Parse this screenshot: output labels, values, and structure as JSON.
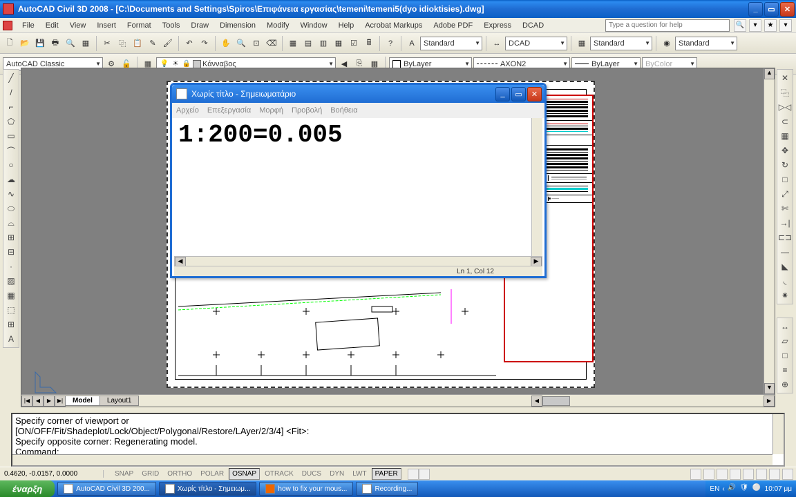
{
  "app": {
    "title": "AutoCAD Civil 3D 2008 - [C:\\Documents and Settings\\Spiros\\Επιφάνεια εργασίας\\temeni\\temeni5(dyo idioktisies).dwg]"
  },
  "menu": {
    "items": [
      "File",
      "Edit",
      "View",
      "Insert",
      "Format",
      "Tools",
      "Draw",
      "Dimension",
      "Modify",
      "Window",
      "Help",
      "Acrobat Markups",
      "Adobe PDF",
      "Express",
      "DCAD"
    ],
    "question_placeholder": "Type a question for help"
  },
  "toolbar_combos": {
    "workspace": "AutoCAD Classic",
    "layer": "Κάνναβος",
    "style1": "Standard",
    "style2": "DCAD",
    "style3": "Standard",
    "style4": "Standard",
    "linetype1": "ByLayer",
    "linetype2": "AXON2",
    "linetype3": "ByLayer",
    "color": "ByColor"
  },
  "tabs": {
    "model": "Model",
    "layout1": "Layout1"
  },
  "notepad": {
    "title": "Χωρίς τίτλο - Σημειωματάριο",
    "menu": [
      "Αρχείο",
      "Επεξεργασία",
      "Μορφή",
      "Προβολή",
      "Βοήθεια"
    ],
    "content": "1:200=0.005",
    "status": "Ln 1, Col 12"
  },
  "command_window": {
    "line1": "Specify corner of viewport or",
    "line2": "[ON/OFF/Fit/Shadeplot/Lock/Object/Polygonal/Restore/LAyer/2/3/4] <Fit>:",
    "line3": "Specify opposite corner: Regenerating model.",
    "line4": "Command:"
  },
  "status": {
    "coords": "0.4620, -0.0157, 0.0000",
    "toggles": [
      "SNAP",
      "GRID",
      "ORTHO",
      "POLAR",
      "OSNAP",
      "OTRACK",
      "DUCS",
      "DYN",
      "LWT",
      "PAPER"
    ],
    "toggle_states": {
      "SNAP": false,
      "GRID": false,
      "ORTHO": false,
      "POLAR": false,
      "OSNAP": true,
      "OTRACK": false,
      "DUCS": false,
      "DYN": false,
      "LWT": false,
      "PAPER": true
    }
  },
  "taskbar": {
    "start": "έναρξη",
    "tasks": [
      {
        "label": "AutoCAD Civil 3D 200...",
        "active": false
      },
      {
        "label": "Χωρίς τίτλο - Σημειωμ...",
        "active": true
      },
      {
        "label": "how to fix your mous...",
        "active": false
      },
      {
        "label": "Recording...",
        "active": false
      }
    ],
    "lang": "EN",
    "clock": "10:07 μμ"
  }
}
